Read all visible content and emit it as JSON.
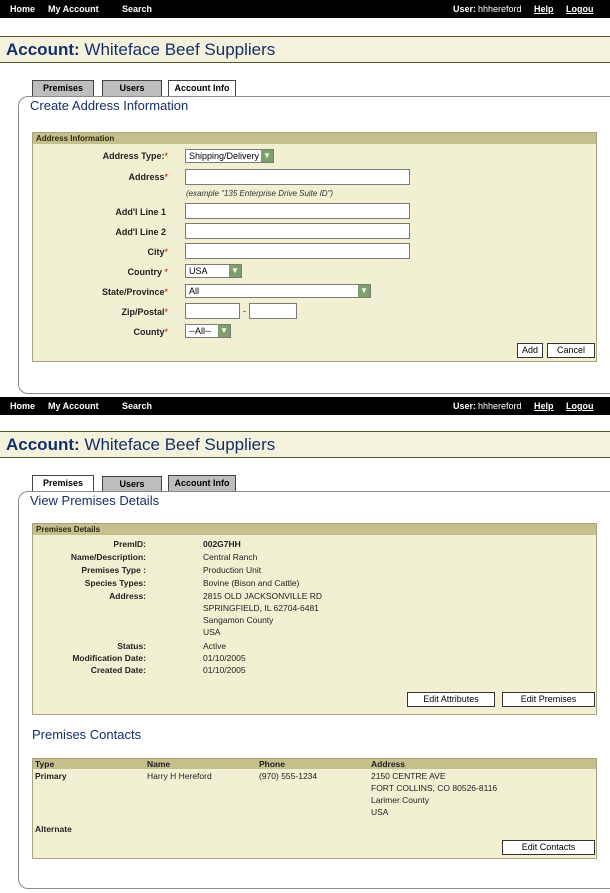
{
  "top_nav": {
    "home": "Home",
    "my_account": "My Account",
    "search": "Search",
    "user_label": "User:",
    "user_name": "hhhereford",
    "help": "Help",
    "logout": "Logou"
  },
  "account": {
    "label": "Account:",
    "name": "Whiteface Beef Suppliers"
  },
  "tabs": [
    "Premises",
    "Users",
    "Account Info"
  ],
  "create_address": {
    "title": "Create Address Information",
    "section_label": "Address Information",
    "fields": {
      "address_type": {
        "label": "Address Type:",
        "value": "Shipping/Delivery"
      },
      "address": {
        "label": "Address",
        "value": ""
      },
      "example": "(example \"135 Enterprise Drive Suite ID\")",
      "addl_line1": {
        "label": "Add'l Line 1",
        "value": ""
      },
      "addl_line2": {
        "label": "Add'l Line 2",
        "value": ""
      },
      "city": {
        "label": "City",
        "value": ""
      },
      "country": {
        "label": "Country",
        "value": "USA"
      },
      "state": {
        "label": "State/Province",
        "value": "All"
      },
      "zip": {
        "label": "Zip/Postal",
        "separator": "-"
      },
      "county": {
        "label": "County",
        "value": "--All--"
      }
    },
    "buttons": {
      "add": "Add",
      "cancel": "Cancel"
    }
  },
  "premises_details": {
    "title": "View Premises Details",
    "section_label": "Premises Details",
    "rows": [
      {
        "label": "PremID:",
        "value": "002G7HH"
      },
      {
        "label": "Name/Description:",
        "value": "Central Ranch"
      },
      {
        "label": "Premises Type :",
        "value": "Production Unit"
      },
      {
        "label": "Species Types:",
        "value": "Bovine (Bison and Cattle)"
      }
    ],
    "address_label": "Address:",
    "address_lines": [
      "2815 OLD JACKSONVILLE RD",
      "SPRINGFIELD, IL 62704-6481",
      "Sangamon County",
      "USA"
    ],
    "status": {
      "label": "Status:",
      "value": "Active"
    },
    "modification": {
      "label": "Modification Date:",
      "value": "01/10/2005"
    },
    "created": {
      "label": "Created Date:",
      "value": "01/10/2005"
    },
    "buttons": {
      "edit_attributes": "Edit Attributes",
      "edit_premises": "Edit Premises"
    }
  },
  "contacts": {
    "title": "Premises Contacts",
    "columns": [
      "Type",
      "Name",
      "Phone",
      "Address"
    ],
    "primary": {
      "type": "Primary",
      "name": "Harry H Hereford",
      "phone": "(970) 555-1234",
      "address_lines": [
        "2150 CENTRE AVE",
        "FORT COLLINS, CO 80526-8116",
        "Larimer County",
        "USA"
      ]
    },
    "alternate": {
      "type": "Alternate"
    },
    "edit_button": "Edit Contacts"
  }
}
